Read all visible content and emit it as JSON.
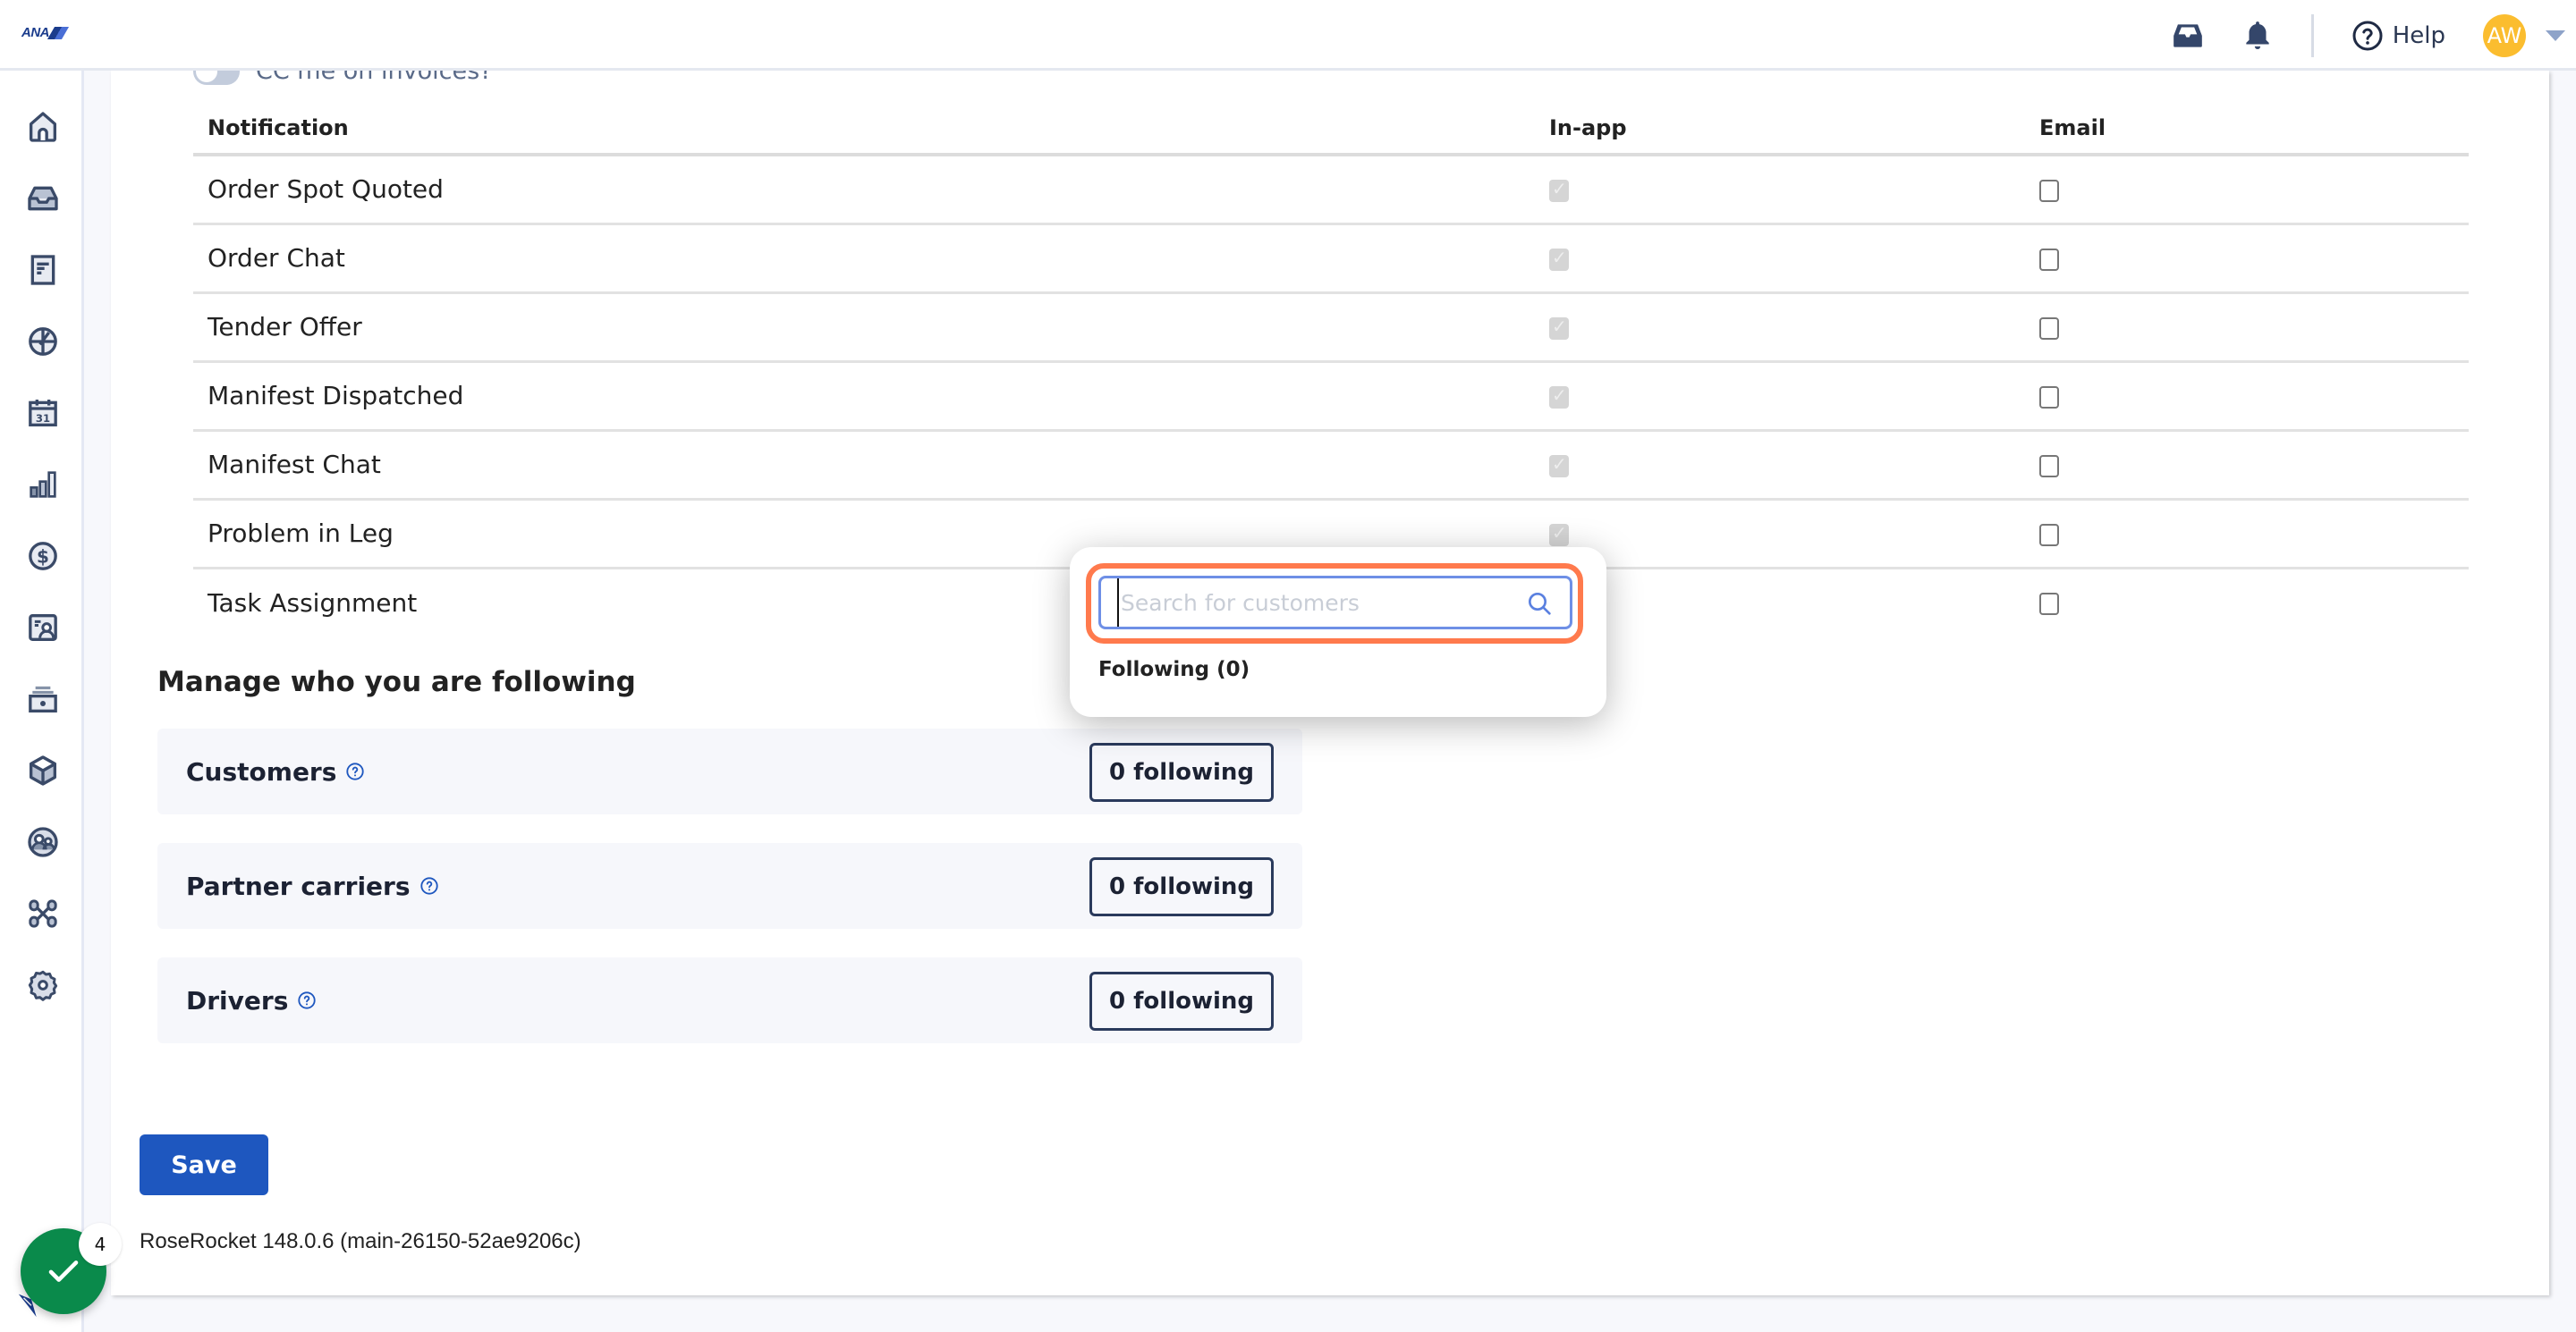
{
  "topbar": {
    "logo_text": "ANA",
    "help_label": "Help",
    "avatar_initials": "AW",
    "icons": [
      "inbox-icon",
      "bell-icon",
      "help-circle-icon",
      "chevron-down-icon"
    ]
  },
  "sidebar": {
    "items": [
      {
        "name": "home",
        "icon": "home-icon"
      },
      {
        "name": "inbox",
        "icon": "inbox-icon"
      },
      {
        "name": "orders",
        "icon": "document-icon"
      },
      {
        "name": "dispatch",
        "icon": "globe-icon"
      },
      {
        "name": "calendar",
        "icon": "calendar-icon",
        "label": "31"
      },
      {
        "name": "reports",
        "icon": "bar-chart-icon"
      },
      {
        "name": "billing",
        "icon": "dollar-icon"
      },
      {
        "name": "contacts",
        "icon": "contact-card-icon"
      },
      {
        "name": "warehouse",
        "icon": "drawer-icon"
      },
      {
        "name": "products",
        "icon": "box-icon"
      },
      {
        "name": "users",
        "icon": "users-icon"
      },
      {
        "name": "integrations",
        "icon": "network-icon"
      },
      {
        "name": "settings",
        "icon": "gear-icon"
      }
    ]
  },
  "main": {
    "cc_toggle": {
      "label": "CC me on invoices?",
      "on": false
    },
    "table": {
      "headers": [
        "Notification",
        "In-app",
        "Email"
      ],
      "rows": [
        {
          "name": "Order Spot Quoted",
          "in_app": true,
          "email": false
        },
        {
          "name": "Order Chat",
          "in_app": true,
          "email": false
        },
        {
          "name": "Tender Offer",
          "in_app": true,
          "email": false
        },
        {
          "name": "Manifest Dispatched",
          "in_app": true,
          "email": false
        },
        {
          "name": "Manifest Chat",
          "in_app": true,
          "email": false
        },
        {
          "name": "Problem in Leg",
          "in_app": true,
          "email": false
        },
        {
          "name": "Task Assignment",
          "in_app": true,
          "email": false
        }
      ]
    },
    "following": {
      "title": "Manage who you are following",
      "groups": [
        {
          "label": "Customers",
          "button": "0 following"
        },
        {
          "label": "Partner carriers",
          "button": "0 following"
        },
        {
          "label": "Drivers",
          "button": "0 following"
        }
      ]
    },
    "save_label": "Save",
    "version": "RoseRocket 148.0.6 (main-26150-52ae9206c)"
  },
  "popover": {
    "search_placeholder": "Search for customers",
    "search_value": "",
    "following_count_label": "Following (0)"
  },
  "checklist_badge": {
    "count": "4"
  },
  "colors": {
    "primary": "#1e57bf",
    "focus_ring": "#ff7a4d",
    "success": "#0a8a4b",
    "avatar": "#fbbd2f",
    "icon": "#3a4a68"
  }
}
